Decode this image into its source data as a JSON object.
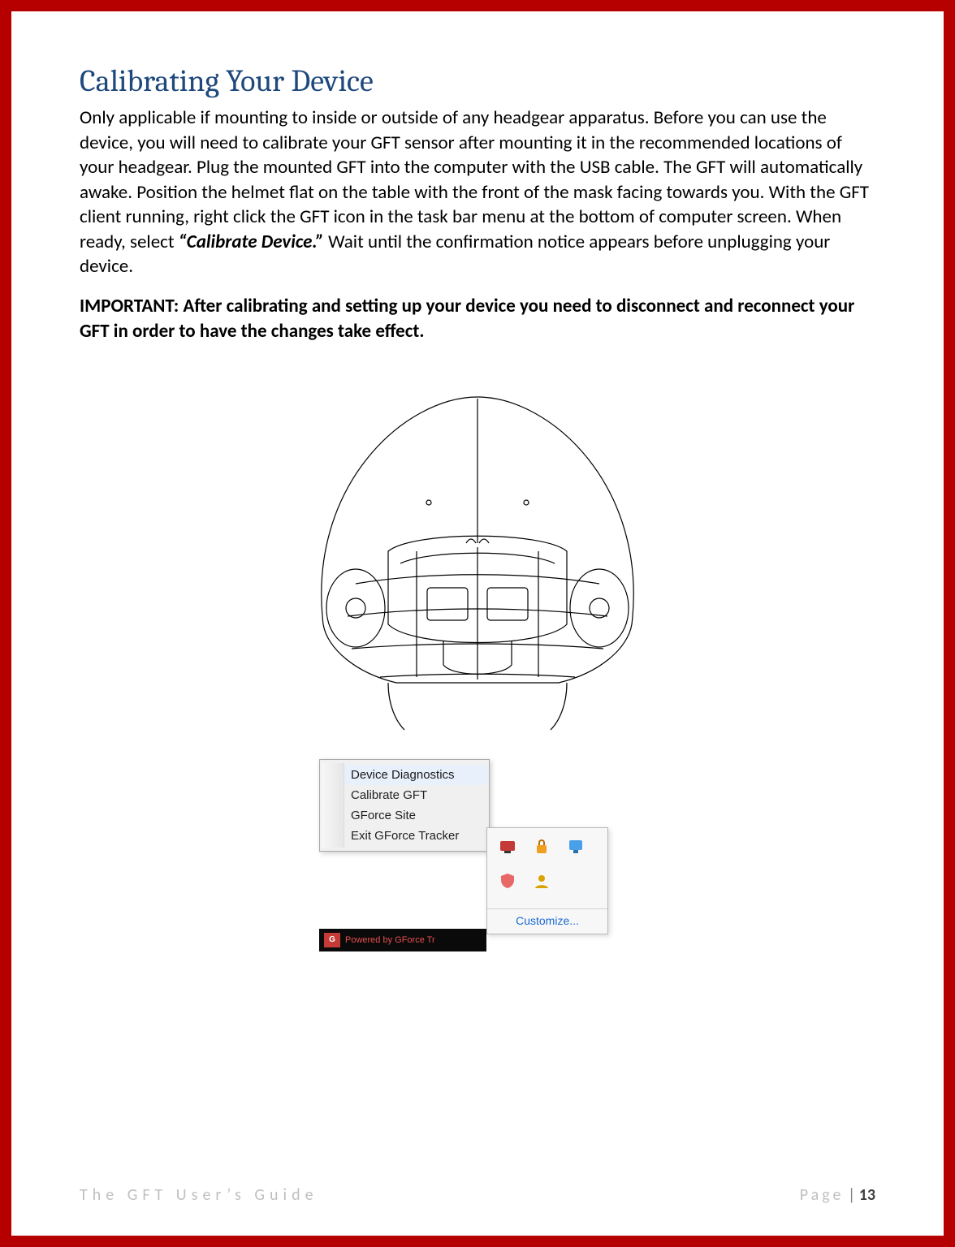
{
  "heading": "Calibrating Your Device",
  "paragraph": {
    "pre": "Only applicable if mounting to inside or outside of any headgear apparatus.  Before you can use the device, you will need to calibrate your GFT sensor after mounting it in the recommended locations of your headgear. Plug the mounted GFT into the computer with the USB cable. The GFT will automatically awake.   Position the helmet flat on the table with the front of the mask facing towards you.  With the GFT client running, right click the GFT icon in the task bar menu at the bottom of computer screen. When ready, select ",
    "bold": "“Calibrate Device.”",
    "post": "  Wait until the confirmation notice appears before unplugging your device."
  },
  "important": "IMPORTANT: After calibrating and setting up your device you need to disconnect and reconnect your GFT in order to have the changes take effect",
  "important_tail": ".",
  "context_menu": {
    "items": [
      "Device Diagnostics",
      "Calibrate GFT",
      "GForce Site",
      "Exit GForce Tracker"
    ]
  },
  "tray": {
    "customize": "Customize...",
    "icons": [
      "gft-icon",
      "security-icon",
      "network-icon",
      "shield-icon",
      "user-icon"
    ]
  },
  "taskbar": {
    "gft_abbrev": "G",
    "powered": "Powered by GForce Tr"
  },
  "footer": {
    "left": "The GFT User’s Guide",
    "page_word": "Page",
    "sep": " | ",
    "num": "13"
  }
}
